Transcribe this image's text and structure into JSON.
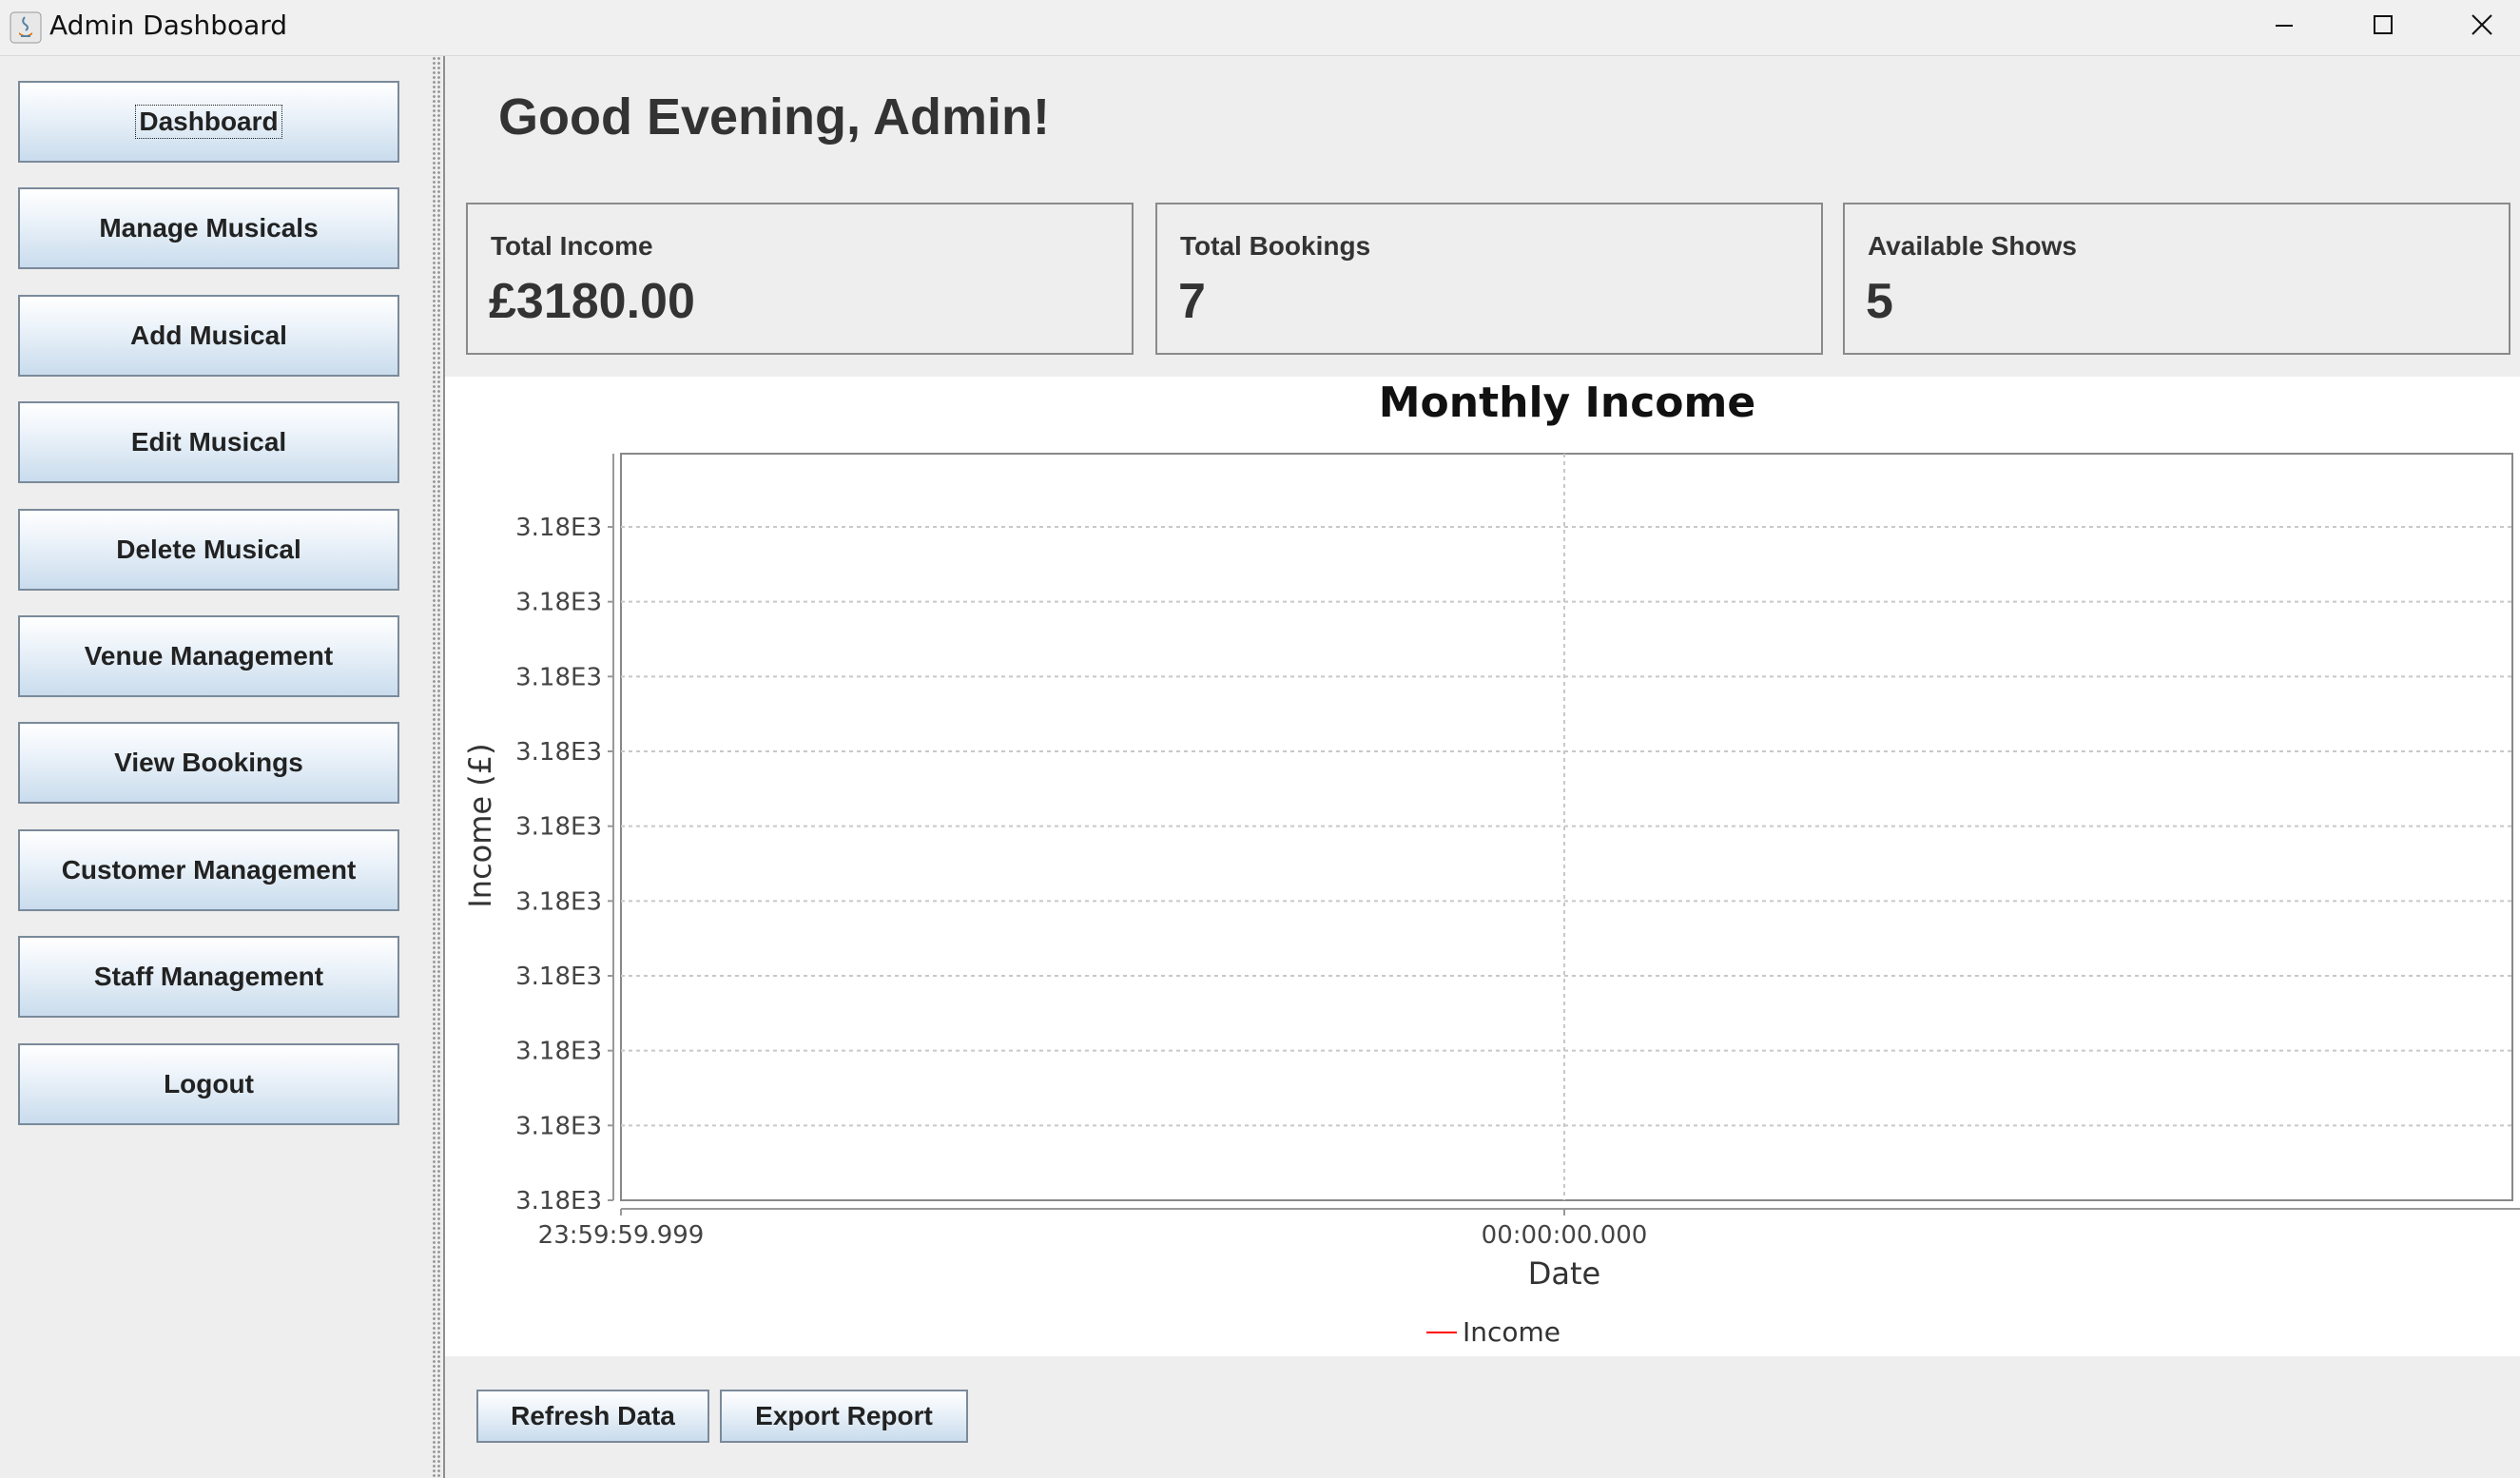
{
  "window": {
    "title": "Admin Dashboard"
  },
  "sidebar": {
    "items": [
      {
        "label": "Dashboard"
      },
      {
        "label": "Manage Musicals"
      },
      {
        "label": "Add Musical"
      },
      {
        "label": "Edit Musical"
      },
      {
        "label": "Delete Musical"
      },
      {
        "label": "Venue Management"
      },
      {
        "label": "View Bookings"
      },
      {
        "label": "Customer Management"
      },
      {
        "label": "Staff Management"
      },
      {
        "label": "Logout"
      }
    ]
  },
  "main": {
    "greeting": "Good Evening, Admin!",
    "stats": [
      {
        "label": "Total Income",
        "value": "£3180.00"
      },
      {
        "label": "Total Bookings",
        "value": "7"
      },
      {
        "label": "Available Shows",
        "value": "5"
      }
    ],
    "actions": {
      "refresh_label": "Refresh Data",
      "export_label": "Export Report"
    }
  },
  "chart_data": {
    "type": "line",
    "title": "Monthly Income",
    "xlabel": "Date",
    "ylabel": "Income (£)",
    "x_tick_labels": [
      "23:59:59.999",
      "00:00:00.000"
    ],
    "y_tick_labels": [
      "3.18E3",
      "3.18E3",
      "3.18E3",
      "3.18E3",
      "3.18E3",
      "3.18E3",
      "3.18E3",
      "3.18E3",
      "3.18E3",
      "3.18E3"
    ],
    "series": [
      {
        "name": "Income",
        "color": "#ff0000",
        "x": [],
        "values": []
      }
    ],
    "grid": true,
    "legend": "bottom"
  }
}
